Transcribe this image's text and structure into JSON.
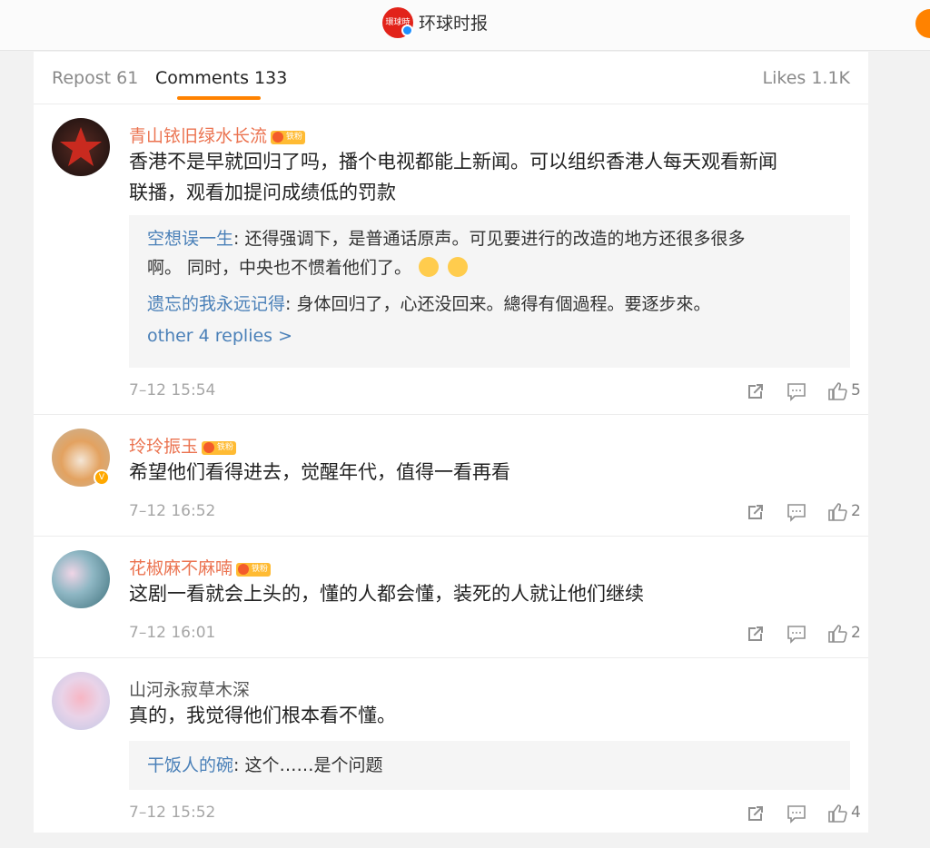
{
  "header": {
    "title": "环球时报",
    "logo_text": "環球時報",
    "logo_icon": "globaltimes-logo-icon",
    "verified_icon": "verified-badge-icon"
  },
  "tabs": [
    {
      "label": "Repost 61"
    },
    {
      "label": "Comments 133"
    },
    {
      "label": "Likes 1.1K"
    }
  ],
  "colors": {
    "accent": "#ff8200",
    "username": "#eb7350",
    "reply_name": "#4a80b8"
  },
  "comments": [
    {
      "user": "青山铱旧绿水长流",
      "fan_badge": "铁粉",
      "text_line1": "香港不是早就回归了吗，播个电视都能上新闻。可以组织香港人每天观看新闻",
      "text_line2": "联播，观看加提问成绩低的罚款",
      "replies": [
        {
          "name": "空想误一生",
          "text_line1": ": 还得强调下，是普通话原声。可见要进行的改造的地方还很多很多",
          "text_line2": "啊。 同时，中央也不惯着他们了。"
        },
        {
          "name": "遗忘的我永远记得",
          "text": ": 身体回归了，心还没回来。總得有個過程。要逐步來。"
        }
      ],
      "more_replies": "other 4 replies >",
      "time": "7–12 15:54",
      "likes": "5"
    },
    {
      "user": "玲玲振玉",
      "fan_badge": "铁粉",
      "text": "希望他们看得进去，觉醒年代，值得一看再看",
      "time": "7–12 16:52",
      "likes": "2"
    },
    {
      "user": "花椒麻不麻喃",
      "fan_badge": "铁粉",
      "text": "这剧一看就会上头的，懂的人都会懂，装死的人就让他们继续",
      "time": "7–12 16:01",
      "likes": "2"
    },
    {
      "user": "山河永寂草木深",
      "text": "真的，我觉得他们根本看不懂。",
      "replies": [
        {
          "name": "干饭人的碗",
          "text": ": 这个……是个问题"
        }
      ],
      "time": "7–12 15:52",
      "likes": "4"
    }
  ]
}
